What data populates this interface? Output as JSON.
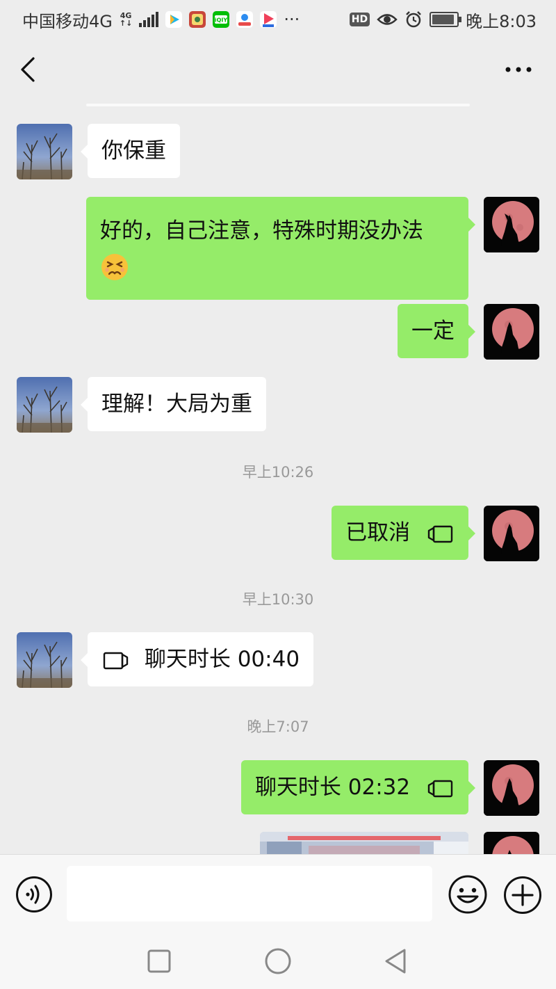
{
  "status_bar": {
    "carrier": "中国移动4G",
    "network_tag_top": "4G",
    "network_tag_bottom": "↑↓",
    "time": "晚上8:03",
    "hd_label": "HD",
    "more_notifications": "···",
    "app_icons": [
      "video-app-icon",
      "game-app-icon",
      "iqiyi-icon",
      "map-app-icon",
      "tv-app-icon"
    ],
    "battery_level": 0.9
  },
  "nav": {
    "back_icon": "chevron-left-icon",
    "more_icon": "more-horizontal-icon"
  },
  "messages": [
    {
      "side": "in",
      "text": "你保重"
    },
    {
      "side": "out",
      "text": "好的，自己注意，特殊时期没办法",
      "emoji": "persevering-face-emoji"
    },
    {
      "side": "out",
      "text": "一定"
    },
    {
      "side": "in",
      "text": "理解！大局为重"
    },
    {
      "side": "out",
      "text": "已取消",
      "icon": "video-call-icon"
    },
    {
      "side": "in",
      "text": "聊天时长 00:40",
      "icon": "video-call-icon"
    },
    {
      "side": "out",
      "text": "聊天时长 02:32",
      "icon": "video-call-icon"
    },
    {
      "side": "out",
      "type": "image"
    }
  ],
  "timestamps": [
    "早上10:26",
    "早上10:30",
    "晚上7:07"
  ],
  "input_bar": {
    "voice_icon": "voice-input-icon",
    "text_value": "",
    "emoji_icon": "smiley-icon",
    "plus_icon": "plus-circle-icon"
  },
  "system_nav": [
    "square-icon",
    "circle-icon",
    "triangle-back-icon"
  ],
  "colors": {
    "background": "#ededed",
    "outgoing_bubble": "#95ec69",
    "incoming_bubble": "#ffffff",
    "timestamp": "#999999"
  }
}
